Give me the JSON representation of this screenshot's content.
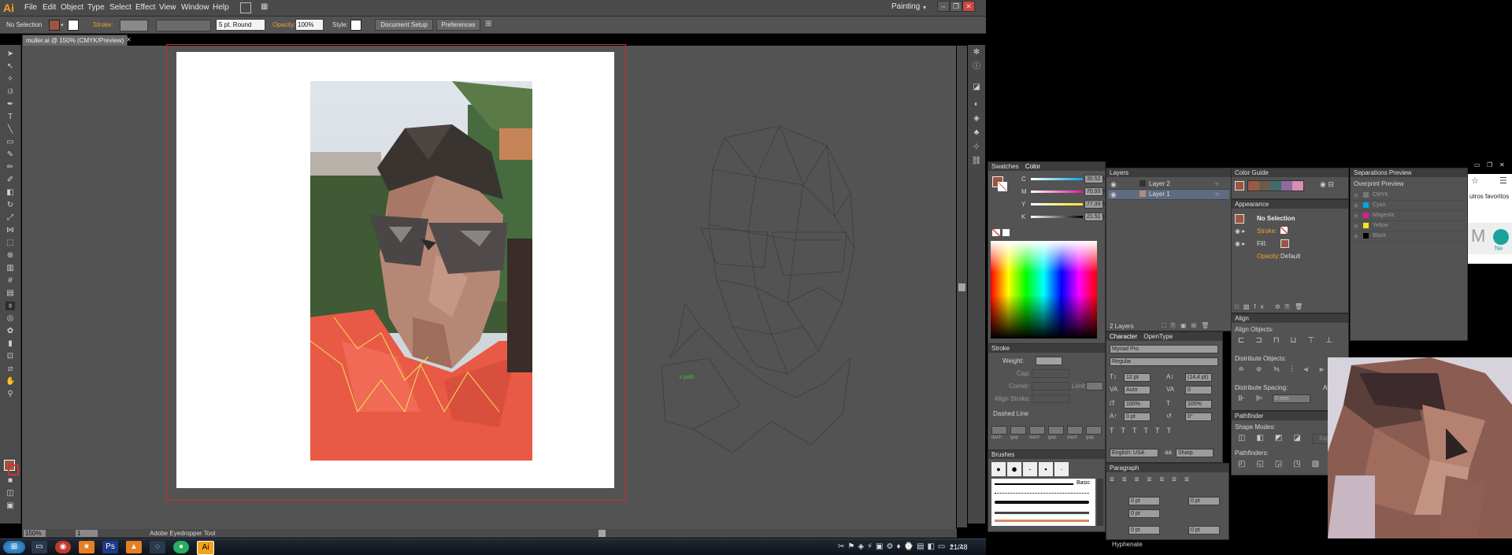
{
  "app": {
    "logo": "Ai",
    "menus": [
      "File",
      "Edit",
      "Object",
      "Type",
      "Select",
      "Effect",
      "View",
      "Window",
      "Help"
    ],
    "workspace": "Painting"
  },
  "control_bar": {
    "selection": "No Selection",
    "stroke_label": "Stroke:",
    "brush": "5 pt. Round",
    "opacity_label": "Opacity:",
    "opacity_value": "100%",
    "style_label": "Style:",
    "document_setup": "Document Setup",
    "preferences": "Preferences"
  },
  "document": {
    "tab_title": "muller.ai @ 150% (CMYK/Preview)",
    "zoom": "150%",
    "page": "1",
    "status_tool": "Adobe Eyedropper Tool"
  },
  "swatches_panel": {
    "tabs": [
      "Swatches",
      "Color"
    ],
    "channels": [
      {
        "name": "C",
        "value": "30.52 %",
        "color": "#00a6e6"
      },
      {
        "name": "M",
        "value": "70.93 %",
        "color": "#e0198e"
      },
      {
        "name": "Y",
        "value": "77.33 %",
        "color": "#f5e51d"
      },
      {
        "name": "K",
        "value": "21.51 %",
        "color": "#000000"
      }
    ]
  },
  "layers_panel": {
    "title": "Layers",
    "layers": [
      "Layer 2",
      "Layer 1"
    ],
    "footer": "2 Layers"
  },
  "color_guide_panel": {
    "title": "Color Guide",
    "colors": [
      "#9b5a44",
      "#6b5c4a",
      "#3f6e6a",
      "#8f6aa0",
      "#d48fb3"
    ]
  },
  "appearance_panel": {
    "title": "Appearance",
    "selection": "No Selection",
    "stroke": "Stroke:",
    "fill": "Fill:",
    "opacity": "Opacity:",
    "opacity_value": "Default"
  },
  "align_panel": {
    "title": "Align",
    "align_objects": "Align Objects:",
    "distribute_objects": "Distribute Objects:",
    "distribute_spacing": "Distribute Spacing:",
    "align_to": "Align To:",
    "spacing_value": "0 mm"
  },
  "pathfinder_panel": {
    "title": "Pathfinder",
    "shape_modes": "Shape Modes:",
    "expand": "Expand",
    "pathfinders": "Pathfinders:"
  },
  "stroke_panel": {
    "title": "Stroke",
    "weight": "Weight:",
    "cap": "Cap:",
    "corner": "Corner:",
    "limit": "Limit:",
    "align_stroke": "Align Stroke:",
    "dashed_line": "Dashed Line",
    "dash_labels": [
      "dash",
      "gap",
      "dash",
      "gap",
      "dash",
      "gap"
    ]
  },
  "brushes_panel": {
    "title": "Brushes",
    "basic": "Basic"
  },
  "character_panel": {
    "tabs": [
      "Character",
      "OpenType"
    ],
    "font": "Myriad Pro",
    "style": "Regular",
    "size": "12 pt",
    "leading": "(14,4 pt)",
    "tracking": "Auto",
    "kerning": "0",
    "hscale": "100%",
    "vscale": "100%",
    "baseline": "0 pt",
    "rotation": "0°",
    "language": "English: USA",
    "aa": "Sharp"
  },
  "paragraph_panel": {
    "title": "Paragraph",
    "fields": [
      "0 pt",
      "0 pt",
      "0 pt",
      "0 pt",
      "0 pt"
    ],
    "hyphenate": "Hyphenate"
  },
  "separations_panel": {
    "title": "Separations Preview",
    "overprint": "Overprint Preview",
    "inks": [
      {
        "name": "CMYK",
        "color": "#777777"
      },
      {
        "name": "Cyan",
        "color": "#00a6e6"
      },
      {
        "name": "Magenta",
        "color": "#e0198e"
      },
      {
        "name": "Yellow",
        "color": "#f5e51d"
      },
      {
        "name": "Black",
        "color": "#000000"
      }
    ]
  },
  "browser_snippet": {
    "text": "utros favoritos",
    "mini_text": "M",
    "mini_text2": "Ne"
  },
  "taskbar": {
    "clock": "21:48"
  }
}
